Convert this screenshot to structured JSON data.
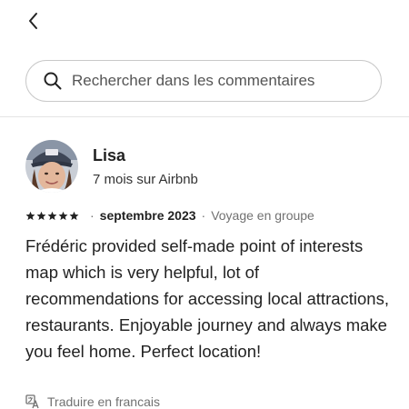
{
  "header": {
    "back_icon": "chevron-left-icon"
  },
  "search": {
    "placeholder": "Rechercher dans les commentaires",
    "value": "",
    "icon": "search-icon"
  },
  "review": {
    "reviewer_name": "Lisa",
    "reviewer_meta": "7 mois sur Airbnb",
    "rating": 5,
    "date": "septembre 2023",
    "separator": "·",
    "trip_type": "Voyage en groupe",
    "text": "Frédéric provided self-made point of interests map which is very helpful, lot of recommendations for accessing local attractions, restaurants. Enjoyable journey and always make you feel home. Perfect location!"
  },
  "translate": {
    "label": "Traduire en francais",
    "icon": "translate-icon"
  }
}
